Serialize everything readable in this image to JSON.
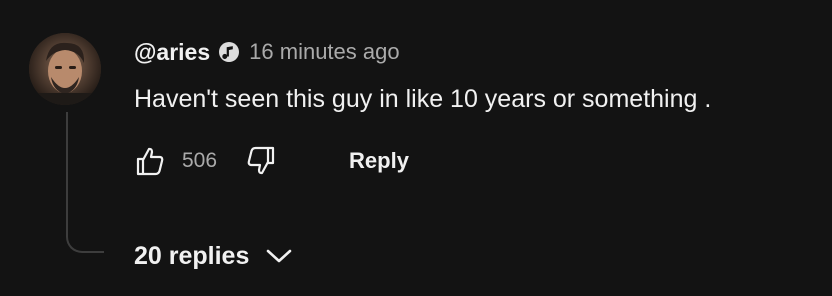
{
  "comment": {
    "handle": "@aries",
    "badge_icon": "music-note-verified-icon",
    "timestamp": "16 minutes ago",
    "text": "Haven't seen this guy in like 10 years or something .",
    "like_count": "506",
    "reply_label": "Reply",
    "replies_label": "20 replies",
    "avatar_icon": "user-avatar"
  },
  "colors": {
    "background": "#131313",
    "primary_text": "#f1f1f1",
    "secondary_text": "#aaaaaa",
    "thread_line": "#3d3d3d"
  }
}
